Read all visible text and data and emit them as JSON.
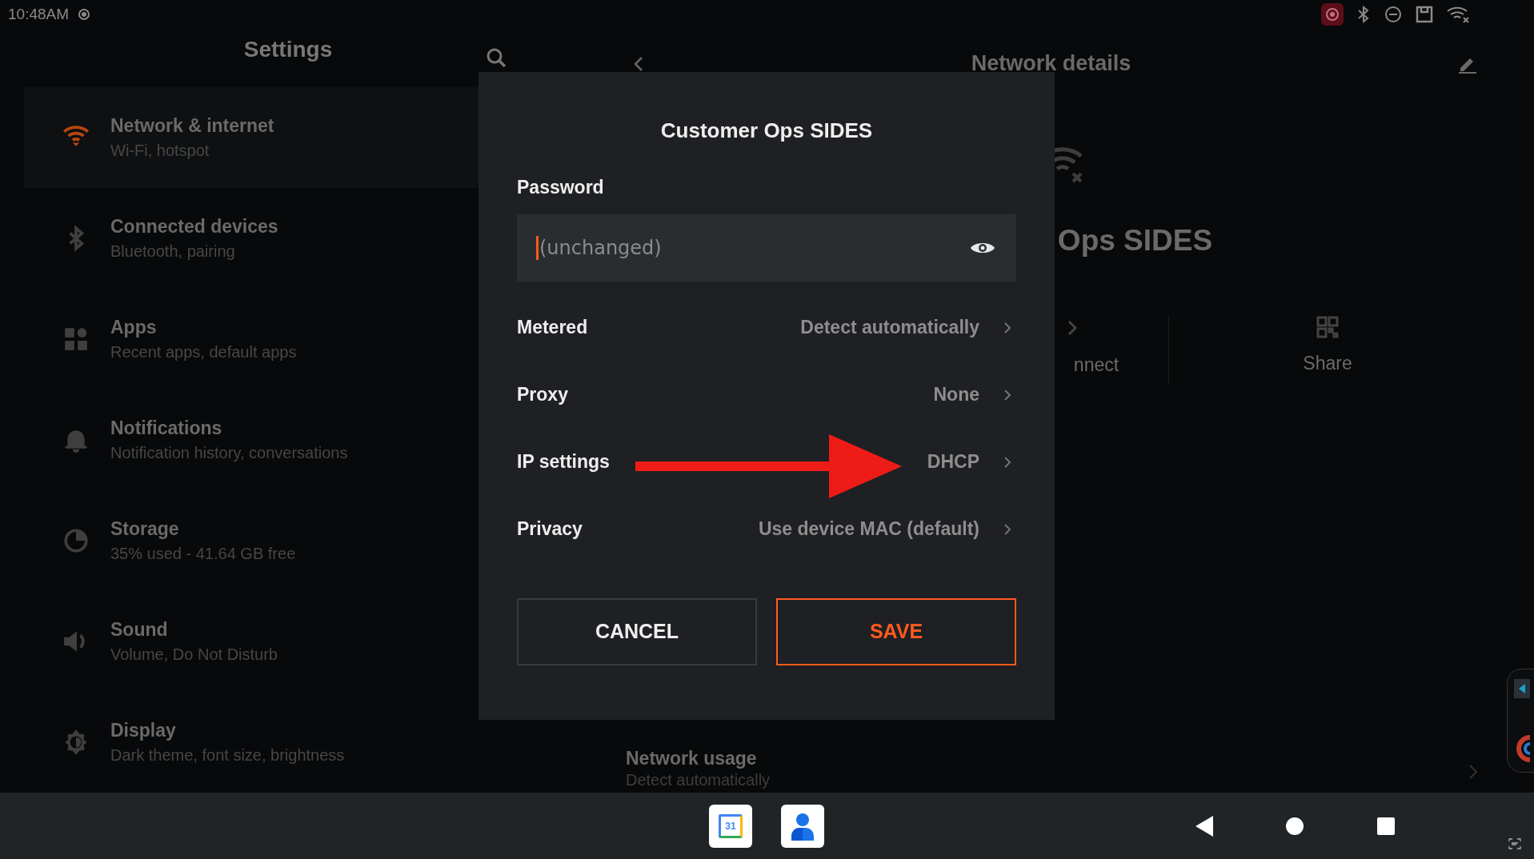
{
  "status_bar": {
    "time": "10:48AM"
  },
  "settings": {
    "title": "Settings",
    "items": [
      {
        "title": "Network & internet",
        "subtitle": "Wi-Fi, hotspot",
        "selected": true
      },
      {
        "title": "Connected devices",
        "subtitle": "Bluetooth, pairing",
        "selected": false
      },
      {
        "title": "Apps",
        "subtitle": "Recent apps, default apps",
        "selected": false
      },
      {
        "title": "Notifications",
        "subtitle": "Notification history, conversations",
        "selected": false
      },
      {
        "title": "Storage",
        "subtitle": "35% used - 41.64 GB free",
        "selected": false
      },
      {
        "title": "Sound",
        "subtitle": "Volume, Do Not Disturb",
        "selected": false
      },
      {
        "title": "Display",
        "subtitle": "Dark theme, font size, brightness",
        "selected": false
      }
    ]
  },
  "network_details": {
    "title": "Network details",
    "network_name": "Ops SIDES",
    "actions": [
      "nnect",
      "Share"
    ],
    "usage": {
      "title": "Network usage",
      "subtitle": "Detect automatically"
    }
  },
  "dialog": {
    "title": "Customer Ops SIDES",
    "password": {
      "label": "Password",
      "placeholder": "(unchanged)"
    },
    "rows": [
      {
        "label": "Metered",
        "value": "Detect automatically"
      },
      {
        "label": "Proxy",
        "value": "None"
      },
      {
        "label": "IP settings",
        "value": "DHCP"
      },
      {
        "label": "Privacy",
        "value": "Use device MAC (default)"
      }
    ],
    "buttons": [
      {
        "label": "CANCEL",
        "primary": false
      },
      {
        "label": "SAVE",
        "primary": true
      }
    ]
  },
  "nav_bar": {
    "calendar_day": "31"
  }
}
